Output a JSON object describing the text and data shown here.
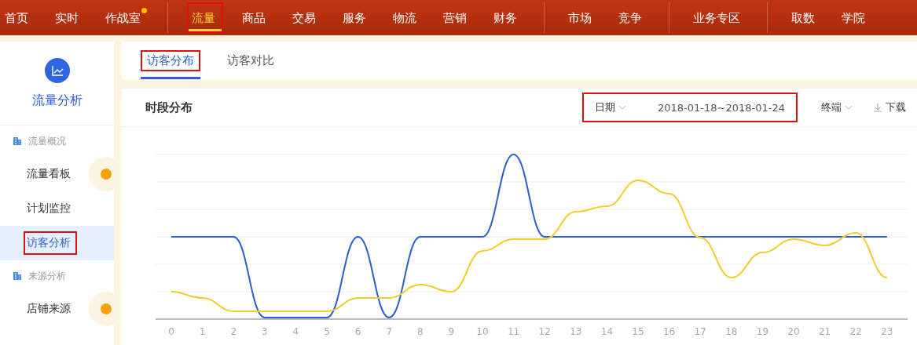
{
  "top_nav": {
    "groups": [
      [
        {
          "label": "首页",
          "selected": false,
          "dot": false,
          "highlight": false
        },
        {
          "label": "实时",
          "selected": false,
          "dot": false,
          "highlight": false
        },
        {
          "label": "作战室",
          "selected": false,
          "dot": true,
          "highlight": false
        }
      ],
      [
        {
          "label": "流量",
          "selected": true,
          "dot": false,
          "highlight": true
        },
        {
          "label": "商品",
          "selected": false,
          "dot": false,
          "highlight": false
        },
        {
          "label": "交易",
          "selected": false,
          "dot": false,
          "highlight": false
        },
        {
          "label": "服务",
          "selected": false,
          "dot": false,
          "highlight": false
        },
        {
          "label": "物流",
          "selected": false,
          "dot": false,
          "highlight": false
        },
        {
          "label": "营销",
          "selected": false,
          "dot": false,
          "highlight": false
        },
        {
          "label": "财务",
          "selected": false,
          "dot": false,
          "highlight": false
        }
      ],
      [
        {
          "label": "市场",
          "selected": false,
          "dot": false,
          "highlight": false
        },
        {
          "label": "竞争",
          "selected": false,
          "dot": false,
          "highlight": false
        }
      ],
      [
        {
          "label": "业务专区",
          "selected": false,
          "dot": false,
          "highlight": false
        }
      ],
      [
        {
          "label": "取数",
          "selected": false,
          "dot": false,
          "highlight": false
        },
        {
          "label": "学院",
          "selected": false,
          "dot": false,
          "highlight": false
        }
      ]
    ]
  },
  "sidebar": {
    "title": "流量分析",
    "sections": [
      {
        "heading": "流量概况",
        "items": [
          {
            "label": "流量看板",
            "selected": false,
            "dot": true,
            "highlight": false
          },
          {
            "label": "计划监控",
            "selected": false,
            "dot": false,
            "highlight": false
          },
          {
            "label": "访客分析",
            "selected": true,
            "dot": false,
            "highlight": true
          }
        ]
      },
      {
        "heading": "来源分析",
        "items": [
          {
            "label": "店铺来源",
            "selected": false,
            "dot": true,
            "highlight": false
          }
        ]
      }
    ]
  },
  "tabs": [
    {
      "label": "访客分布",
      "selected": true,
      "highlight": true
    },
    {
      "label": "访客对比",
      "selected": false,
      "highlight": false
    }
  ],
  "card": {
    "title": "时段分布",
    "date_filter": {
      "label": "日期",
      "range": "2018-01-18~2018-01-24",
      "highlight": true
    },
    "device_filter": "终端",
    "download": "下载",
    "x_labels": [
      "0",
      "1",
      "2",
      "3",
      "4",
      "5",
      "6",
      "7",
      "8",
      "9",
      "10",
      "11",
      "12",
      "13",
      "14",
      "15",
      "16",
      "17",
      "18",
      "19",
      "20",
      "21",
      "22",
      "23"
    ]
  }
}
